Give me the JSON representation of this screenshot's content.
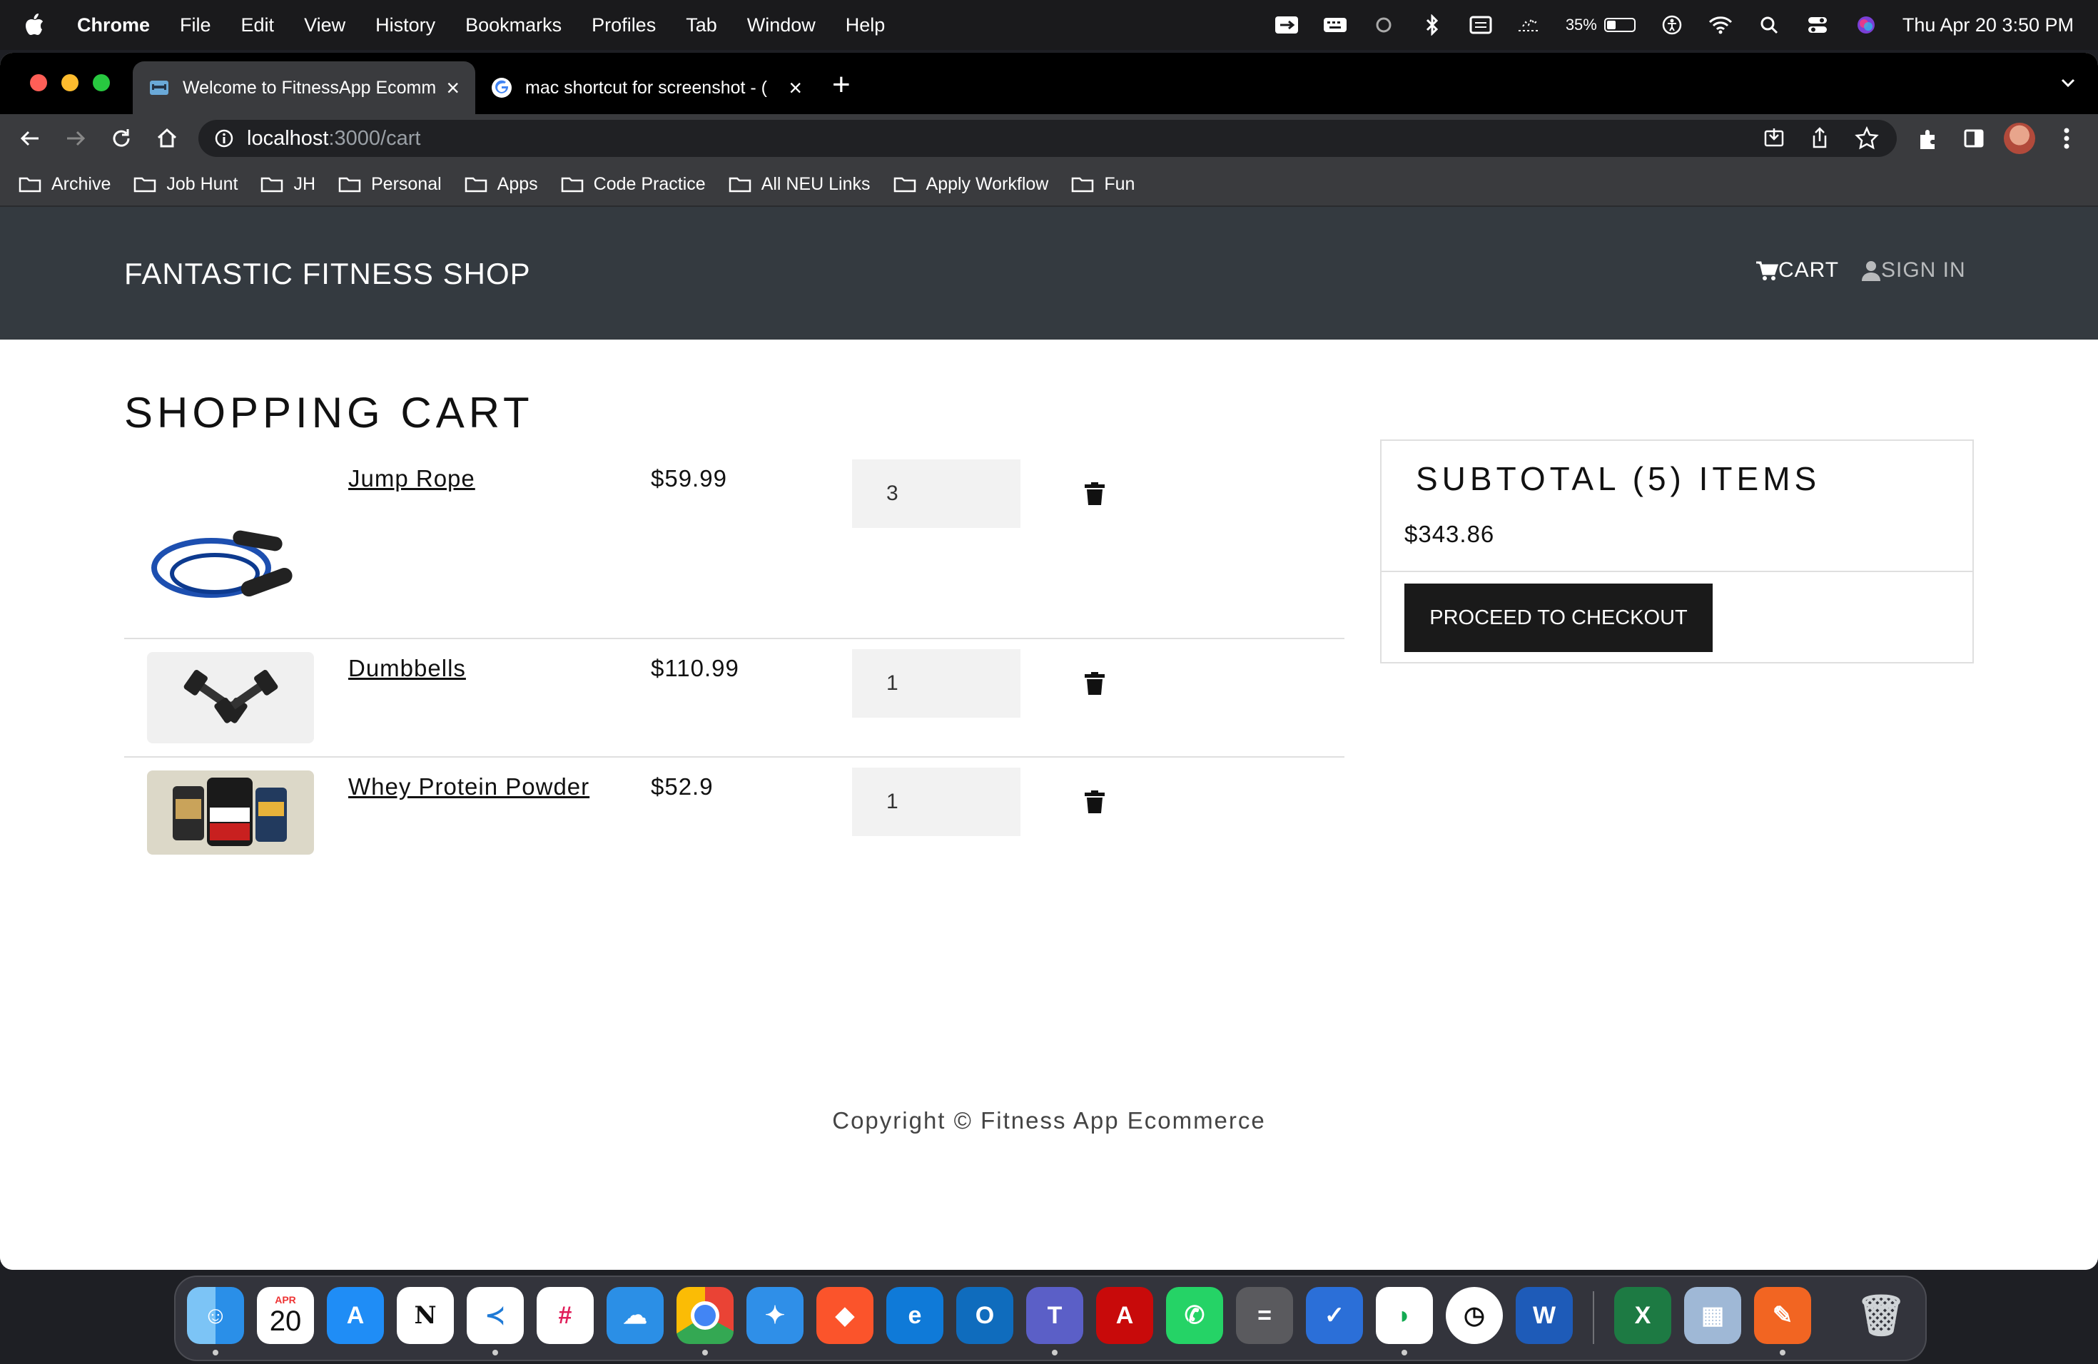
{
  "menubar": {
    "app_name": "Chrome",
    "menus": [
      "File",
      "Edit",
      "View",
      "History",
      "Bookmarks",
      "Profiles",
      "Tab",
      "Window",
      "Help"
    ],
    "battery_percent": "35%",
    "battery_level": 0.35,
    "datetime": "Thu Apr 20  3:50 PM"
  },
  "browser": {
    "tabs": [
      {
        "title": "Welcome to FitnessApp Ecomm",
        "favicon": "fitness-app-favicon"
      },
      {
        "title": "mac shortcut for screenshot - (",
        "favicon": "google-favicon"
      }
    ],
    "url_host": "localhost",
    "url_path": ":3000/cart",
    "bookmarks": [
      "Archive",
      "Job Hunt",
      "JH",
      "Personal",
      "Apps",
      "Code Practice",
      "All NEU Links",
      "Apply Workflow",
      "Fun"
    ]
  },
  "site": {
    "brand": "FANTASTIC FITNESS SHOP",
    "nav_cart": "CART",
    "nav_signin": "SIGN IN"
  },
  "cart": {
    "title": "SHOPPING CART",
    "items": [
      {
        "name": "Jump Rope",
        "price": "$59.99",
        "qty": "3"
      },
      {
        "name": "Dumbbells",
        "price": "$110.99",
        "qty": "1"
      },
      {
        "name": "Whey Protein Powder",
        "price": "$52.9",
        "qty": "1"
      }
    ]
  },
  "summary": {
    "heading": "SUBTOTAL (5) ITEMS",
    "total": "$343.86",
    "checkout_label": "PROCEED TO CHECKOUT"
  },
  "footer": {
    "text": "Copyright © Fitness App Ecommerce"
  },
  "dock": {
    "calendar_month": "APR",
    "calendar_day": "20",
    "apps": [
      "finder",
      "calendar",
      "app-store",
      "notion",
      "vscode",
      "slack",
      "icloud",
      "chrome",
      "safari",
      "brave",
      "edge",
      "outlook",
      "teams",
      "acrobat",
      "whatsapp",
      "calculator",
      "todo",
      "mongodb",
      "clock",
      "word",
      "excel",
      "preview",
      "pages-pen",
      "trash"
    ]
  },
  "colors": {
    "header_bg": "#343a40",
    "button_bg": "#1a1a1a",
    "qty_bg": "#f2f2f2"
  }
}
